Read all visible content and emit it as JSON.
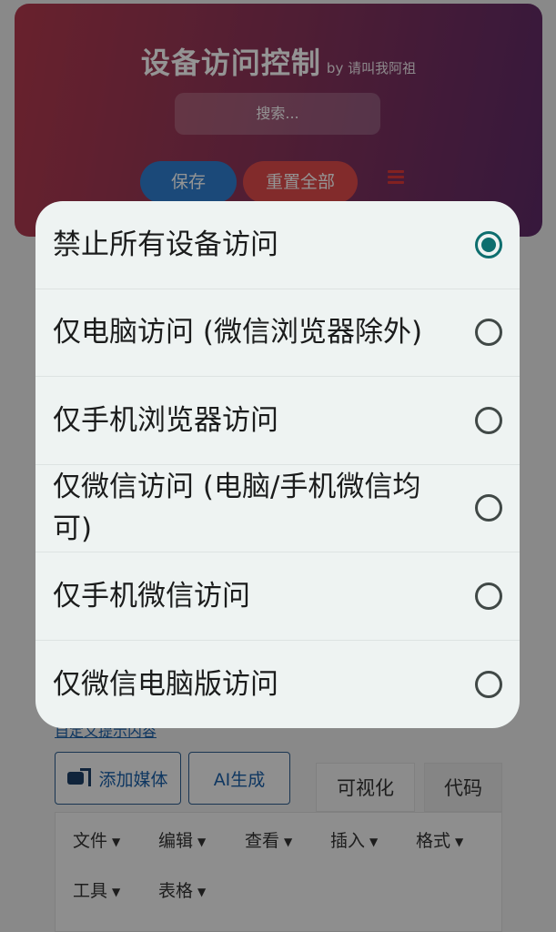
{
  "header": {
    "title": "设备访问控制",
    "byline": "by 请叫我阿祖",
    "search_placeholder": "搜索...",
    "save_label": "保存",
    "reset_label": "重置全部"
  },
  "editor": {
    "custom_prompt_link": "自定义提示内容",
    "add_media_label": "添加媒体",
    "ai_generate_label": "AI生成",
    "tabs": {
      "visual": "可视化",
      "code": "代码"
    },
    "menus": [
      "文件",
      "编辑",
      "查看",
      "插入",
      "格式",
      "工具",
      "表格"
    ]
  },
  "dialog": {
    "options": [
      {
        "label": "禁止所有设备访问",
        "selected": true
      },
      {
        "label": "仅电脑访问 (微信浏览器除外)",
        "selected": false
      },
      {
        "label": "仅手机浏览器访问",
        "selected": false
      },
      {
        "label": "仅微信访问 (电脑/手机微信均可)",
        "selected": false
      },
      {
        "label": "仅手机微信访问",
        "selected": false
      },
      {
        "label": "仅微信电脑版访问",
        "selected": false
      }
    ]
  },
  "colors": {
    "accent": "#0d6e6e",
    "save_button": "#2f7fd0",
    "reset_button": "#e04a4a"
  },
  "icons": [
    "menu-icon",
    "media-icon",
    "radio-checked",
    "radio-unchecked"
  ]
}
